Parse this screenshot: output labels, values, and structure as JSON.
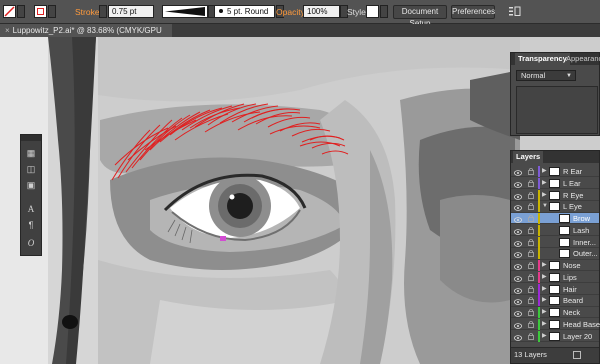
{
  "control_bar": {
    "stroke_label": "Stroke",
    "stroke_weight": "0.75 pt",
    "brush_label": "5 pt. Round",
    "opacity_label": "Opacity:",
    "opacity_value": "100%",
    "style_label": "Style:",
    "document_setup": "Document Setup",
    "preferences": "Preferences"
  },
  "document_tab": {
    "close": "×",
    "title": "Luppowitz_P2.ai* @ 83.68% (CMYK/GPU Preview)"
  },
  "transparency_panel": {
    "tabs": [
      "Transparency",
      "Appearance"
    ],
    "blend_mode": "Normal"
  },
  "layers_panel": {
    "tab": "Layers",
    "footer": "13 Layers",
    "rows": [
      {
        "name": "R Ear",
        "color": "#7e5bd6",
        "level": 0,
        "selected": false
      },
      {
        "name": "L Ear",
        "color": "#7e5bd6",
        "level": 0,
        "selected": false
      },
      {
        "name": "R Eye",
        "color": "#c8b400",
        "level": 0,
        "selected": false
      },
      {
        "name": "L Eye",
        "color": "#c8b400",
        "level": 0,
        "selected": false
      },
      {
        "name": "Brow",
        "color": "#c8b400",
        "level": 1,
        "selected": true
      },
      {
        "name": "Lash",
        "color": "#c8b400",
        "level": 1,
        "selected": false
      },
      {
        "name": "Inner...",
        "color": "#c8b400",
        "level": 1,
        "selected": false
      },
      {
        "name": "Outer...",
        "color": "#c8b400",
        "level": 1,
        "selected": false
      },
      {
        "name": "Nose",
        "color": "#e53a8a",
        "level": 0,
        "selected": false
      },
      {
        "name": "Lips",
        "color": "#e53a8a",
        "level": 0,
        "selected": false
      },
      {
        "name": "Hair",
        "color": "#9c2ad6",
        "level": 0,
        "selected": false
      },
      {
        "name": "Beard",
        "color": "#9c2ad6",
        "level": 0,
        "selected": false
      },
      {
        "name": "Neck",
        "color": "#3cc83c",
        "level": 0,
        "selected": false
      },
      {
        "name": "Head Base",
        "color": "#3cc83c",
        "level": 0,
        "selected": false
      },
      {
        "name": "Layer 20",
        "color": "#3cc83c",
        "level": 0,
        "selected": false
      }
    ]
  },
  "colors": {
    "accent_stroke": "#e02020",
    "selection": "#7aa0d4"
  }
}
